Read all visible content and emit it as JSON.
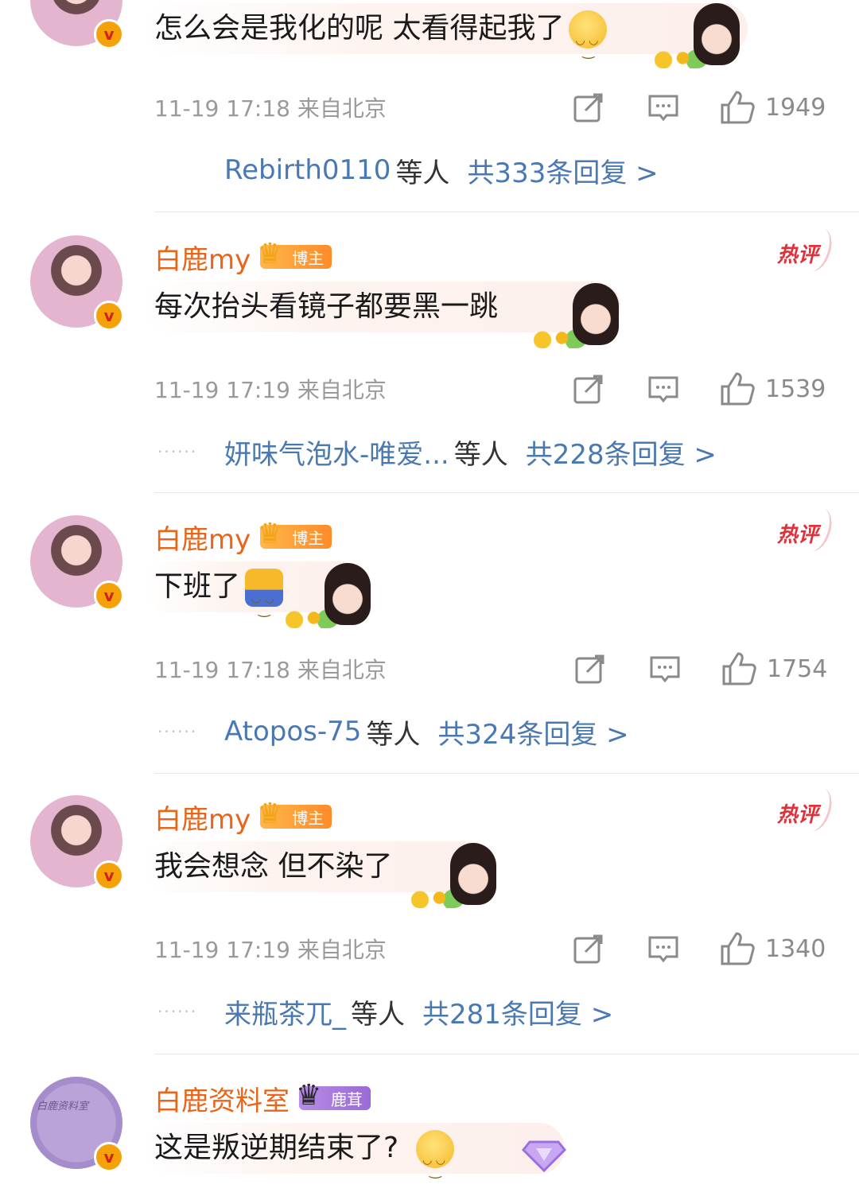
{
  "comments": [
    {
      "username": "",
      "text": "怎么会是我化的呢 太看得起我了",
      "time": "11-19 17:18 来自北京",
      "likes": "1949",
      "reply_names": "Rebirth0110",
      "reply_others": "等人",
      "reply_total": "共333条回复 >"
    },
    {
      "username": "白鹿my",
      "badge": "博主",
      "hot": "热评",
      "text": "每次抬头看镜子都要黑一跳",
      "time": "11-19 17:19 来自北京",
      "likes": "1539",
      "reply_names": "妍味气泡水-唯爱...",
      "reply_others": "等人",
      "reply_total": "共228条回复 >"
    },
    {
      "username": "白鹿my",
      "badge": "博主",
      "hot": "热评",
      "text": "下班了",
      "time": "11-19 17:18 来自北京",
      "likes": "1754",
      "reply_names": "Atopos-75",
      "reply_others": "等人",
      "reply_total": "共324条回复 >"
    },
    {
      "username": "白鹿my",
      "badge": "博主",
      "hot": "热评",
      "text": "我会想念 但不染了",
      "time": "11-19 17:19 来自北京",
      "likes": "1340",
      "reply_names": "来瓶茶兀_",
      "reply_others": "等人",
      "reply_total": "共281条回复 >"
    },
    {
      "username": "白鹿资料室",
      "badge": "鹿茸",
      "text": "这是叛逆期结束了?"
    }
  ],
  "avatar_signature": "白鹿资料室",
  "verified_mark": "v",
  "colors": {
    "username": "#e8651a",
    "link": "#4a78b0",
    "hot": "#e0303a",
    "meta": "#9a9a9a"
  }
}
